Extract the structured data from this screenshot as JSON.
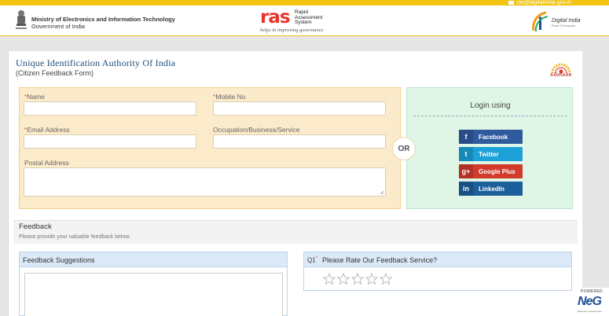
{
  "header": {
    "email": "ras@digitalindia.gov.in",
    "ministry_line1": "Ministry of Electronics and Information Technology",
    "ministry_line2": "Government of India",
    "emblem_caption": "सत्यमेव जयते",
    "ras_logo": "ras",
    "ras_sub1": "Rapid",
    "ras_sub2": "Assessment",
    "ras_sub3": "System",
    "ras_tagline": "helps in improving governance",
    "digital_india": "Digital India",
    "digital_india_sub": "Power To Empower"
  },
  "form": {
    "title": "Unique Identification Authority Of India",
    "subtitle": "(Citizen Feedback Form)",
    "aadhaar_label": "AADHAAR",
    "required_mark": "*",
    "fields": {
      "name_label": "Name",
      "mobile_label": "Mobile No",
      "email_label": "Email Address",
      "occupation_label": "Occupation/Business/Service",
      "postal_label": "Postal Address"
    },
    "or_label": "OR"
  },
  "login": {
    "title": "Login using",
    "buttons": {
      "facebook": "Facebook",
      "twitter": "Twitter",
      "google": "Google Plus",
      "linkedin": "LinkedIn"
    },
    "icons": {
      "facebook": "f",
      "twitter": "t",
      "google": "g+",
      "linkedin": "in"
    },
    "colors": {
      "facebook": "#2f5a9e",
      "twitter": "#1da1d9",
      "google": "#d23a2b",
      "linkedin": "#1d5f9b"
    }
  },
  "feedback": {
    "title": "Feedback",
    "note": "Please provide your valuable feedback below.",
    "suggestions_label": "Feedback Suggestions",
    "question_no": "Q1",
    "question_mark": "*",
    "question": "Please Rate Our Feedback Service?",
    "rating_max": 5,
    "rating_value": 0
  },
  "footer": {
    "powered": "POWERED",
    "logo": "NeG",
    "logo_sub": "National e-Governance"
  }
}
